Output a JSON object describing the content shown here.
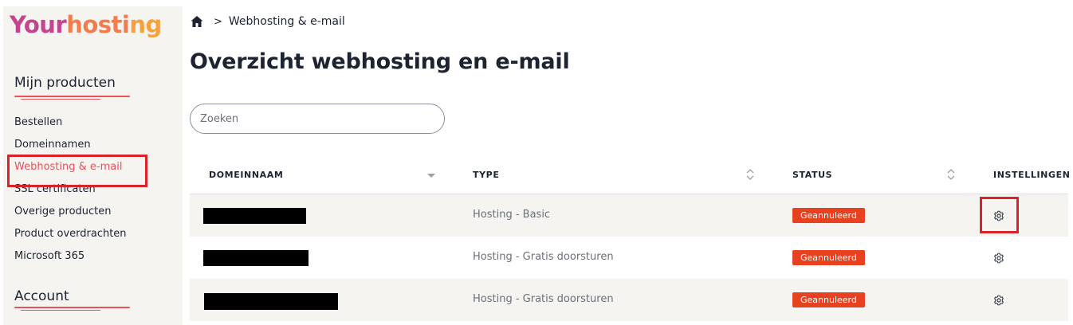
{
  "brand": {
    "logo_part1": "Your",
    "logo_part2": "hosti",
    "logo_part3": "ng"
  },
  "sidebar": {
    "section1_title": "Mijn producten",
    "items": [
      {
        "label": "Bestellen"
      },
      {
        "label": "Domeinnamen"
      },
      {
        "label": "Webhosting & e-mail"
      },
      {
        "label": "SSL certificaten"
      },
      {
        "label": "Overige producten"
      },
      {
        "label": "Product overdrachten"
      },
      {
        "label": "Microsoft 365"
      }
    ],
    "section2_title": "Account"
  },
  "breadcrumb": {
    "separator": ">",
    "current": "Webhosting & e-mail"
  },
  "page": {
    "title": "Overzicht webhosting en e-mail"
  },
  "search": {
    "placeholder": "Zoeken"
  },
  "table": {
    "headers": {
      "domain": "DOMEINNAAM",
      "type": "TYPE",
      "status": "STATUS",
      "settings": "INSTELLINGEN"
    },
    "rows": [
      {
        "type": "Hosting - Basic",
        "status": "Geannuleerd"
      },
      {
        "type": "Hosting - Gratis doorsturen",
        "status": "Geannuleerd"
      },
      {
        "type": "Hosting - Gratis doorsturen",
        "status": "Geannuleerd"
      }
    ]
  },
  "colors": {
    "accent": "#e8525a",
    "highlight": "#d8232a",
    "badge": "#e8411f",
    "sidebar_bg": "#f5f4f0"
  },
  "icons": {
    "home": "home-icon",
    "chevron": "chevron-right-icon",
    "sort": "sort-icon",
    "settings": "gear-icon"
  }
}
